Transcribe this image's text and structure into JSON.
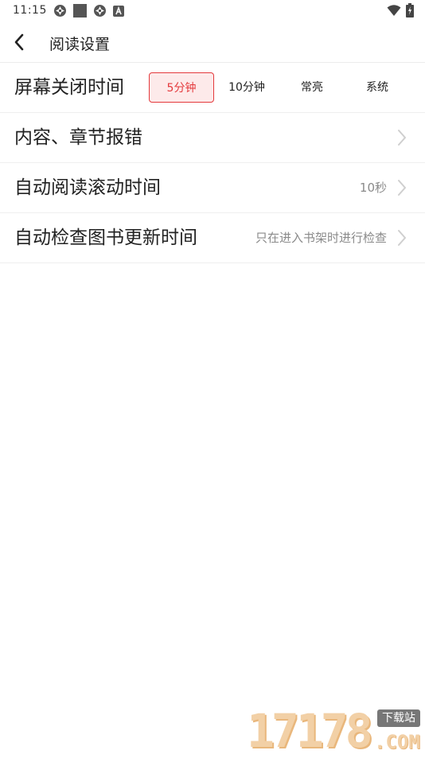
{
  "status_bar": {
    "time": "11:15",
    "left_icons": [
      "sync-icon",
      "square-icon",
      "sync-icon",
      "a-badge-icon"
    ],
    "right_icons": [
      "wifi-icon",
      "battery-icon"
    ]
  },
  "header": {
    "title": "阅读设置"
  },
  "settings": {
    "screen_timeout": {
      "label": "屏幕关闭时间",
      "options": [
        "5分钟",
        "10分钟",
        "常亮",
        "系统"
      ],
      "selected": "5分钟"
    },
    "report_error": {
      "label": "内容、章节报错"
    },
    "auto_scroll": {
      "label": "自动阅读滚动时间",
      "value": "10秒"
    },
    "update_check": {
      "label": "自动检查图书更新时间",
      "value": "只在进入书架时进行检查"
    }
  },
  "watermark": {
    "digits": "17178",
    "badge": "下载站",
    "domain": ".COM"
  },
  "colors": {
    "accent": "#e4393c",
    "accent_bg": "#fdeaea",
    "secondary_text": "#8a8a8a",
    "divider": "#efefef"
  }
}
